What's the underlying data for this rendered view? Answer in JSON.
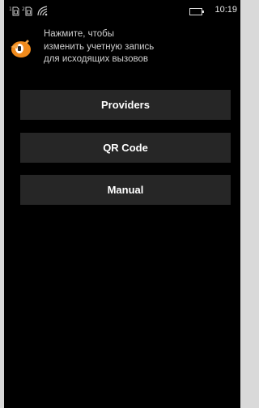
{
  "status_bar": {
    "time": "10:19",
    "icons": [
      "sim-1-icon",
      "sim-2-icon",
      "wifi-icon",
      "battery-icon"
    ]
  },
  "account": {
    "logo_icon": "orange-phone-logo-icon",
    "lines": [
      "Нажмите, чтобы",
      "изменить учетную запись",
      "для исходящих вызовов"
    ]
  },
  "menu": {
    "providers_label": "Providers",
    "qr_label": "QR Code",
    "manual_label": "Manual"
  },
  "colors": {
    "background": "#000000",
    "button": "#262626",
    "accent": "#f08a1c"
  }
}
